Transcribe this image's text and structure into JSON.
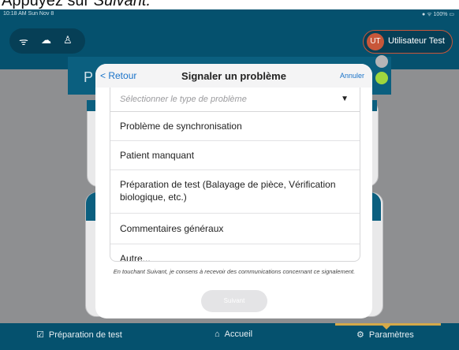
{
  "caption": {
    "prefix": "Appuyez sur ",
    "emphasis": "Suivant."
  },
  "status_bar": {
    "time": "10:18 AM  Sun Nov 8",
    "battery": "100%"
  },
  "header": {
    "user_initials": "UT",
    "user_name": "Utilisateur Test",
    "page_initial": "P"
  },
  "modal": {
    "back_label": "Retour",
    "title": "Signaler un problème",
    "cancel_label": "Annuler",
    "select_placeholder": "Sélectionner le type de problème",
    "options": [
      "Problème de synchronisation",
      "Patient manquant",
      "Préparation de test (Balayage de pièce, Vérification biologique, etc.)",
      "Commentaires généraux",
      "Autre..."
    ],
    "consent_text": "En touchant Suivant, je consens à recevoir des communications concernant ce signalement.",
    "submit_label": "Suivant"
  },
  "bottom_nav": [
    {
      "label": "Préparation de test",
      "icon": "clipboard-check-icon",
      "active": false
    },
    {
      "label": "Accueil",
      "icon": "home-icon",
      "active": false
    },
    {
      "label": "Paramètres",
      "icon": "gear-icon",
      "active": true
    }
  ],
  "colors": {
    "primary": "#05516e",
    "accent": "#d4a94a",
    "link": "#1a73c9",
    "avatar": "#c8573a"
  }
}
